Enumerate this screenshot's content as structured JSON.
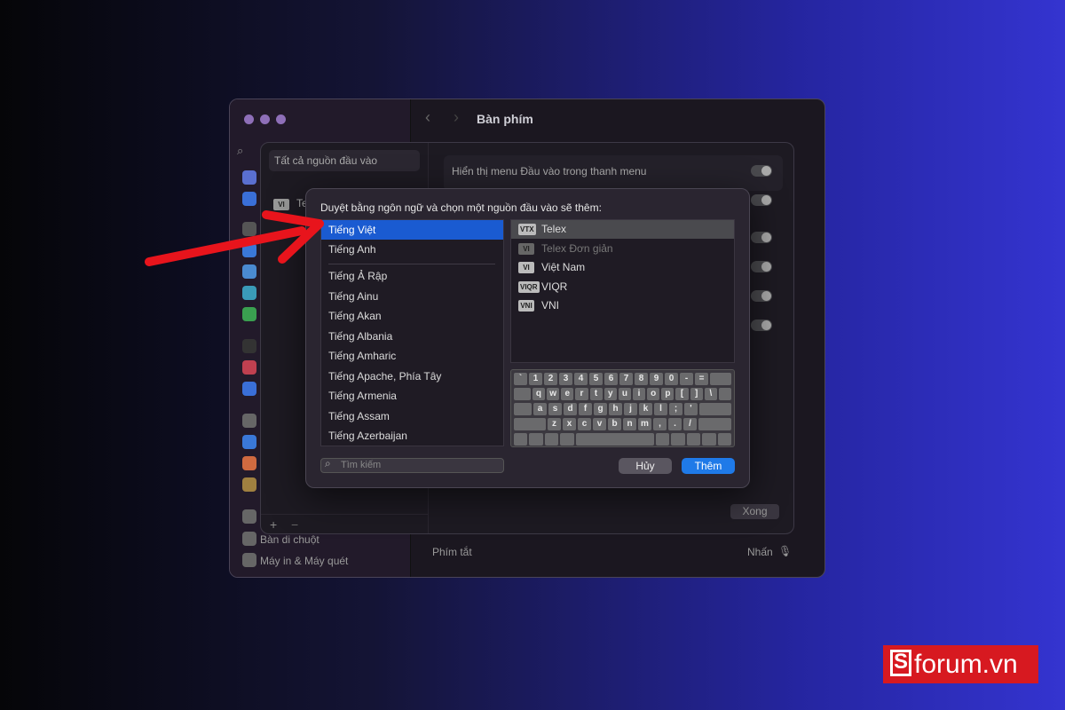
{
  "window": {
    "title": "Bàn phím"
  },
  "sidebar": {
    "items": [
      {
        "label": "Bàn di chuột"
      },
      {
        "label": "Máy in & Máy quét"
      }
    ]
  },
  "sheet": {
    "sources_header": "Tất cả nguồn đầu vào",
    "source_item": "Te",
    "source_badge": "VI",
    "setting_label": "Hiển thị menu Đầu vào trong thanh menu",
    "done_label": "Xong",
    "add": "+",
    "remove": "−"
  },
  "settings": {
    "shortcut_label": "Phím tắt",
    "shortcut_value": "Nhấn"
  },
  "dialog": {
    "title": "Duyệt bằng ngôn ngữ và chọn một nguồn đầu vào sẽ thêm:",
    "languages_top": [
      "Tiếng Việt",
      "Tiếng Anh"
    ],
    "languages": [
      "Tiếng Ả Rập",
      "Tiếng Ainu",
      "Tiếng Akan",
      "Tiếng Albania",
      "Tiếng Amharic",
      "Tiếng Apache, Phía Tây",
      "Tiếng Armenia",
      "Tiếng Assam",
      "Tiếng Azerbaijan"
    ],
    "sources": [
      {
        "badge": "VTX",
        "label": "Telex"
      },
      {
        "badge": "VI",
        "label": "Telex Đơn giản"
      },
      {
        "badge": "VI",
        "label": "Việt Nam"
      },
      {
        "badge": "VIQR",
        "label": "VIQR"
      },
      {
        "badge": "VNI",
        "label": "VNI"
      }
    ],
    "keyboard_rows": [
      [
        "`",
        "1",
        "2",
        "3",
        "4",
        "5",
        "6",
        "7",
        "8",
        "9",
        "0",
        "-",
        "="
      ],
      [
        "q",
        "w",
        "e",
        "r",
        "t",
        "y",
        "u",
        "i",
        "o",
        "p",
        "[",
        "]",
        "\\"
      ],
      [
        "a",
        "s",
        "d",
        "f",
        "g",
        "h",
        "j",
        "k",
        "l",
        ";",
        "'"
      ],
      [
        "z",
        "x",
        "c",
        "v",
        "b",
        "n",
        "m",
        ",",
        ".",
        "/"
      ]
    ],
    "search_placeholder": "Tìm kiếm",
    "cancel_label": "Hủy",
    "add_label": "Thêm"
  },
  "watermark": {
    "text": "forum.vn",
    "mark": "S"
  },
  "colors": {
    "selection": "#1a5bd1",
    "arrow": "#e8141c",
    "brand": "#d71920"
  }
}
